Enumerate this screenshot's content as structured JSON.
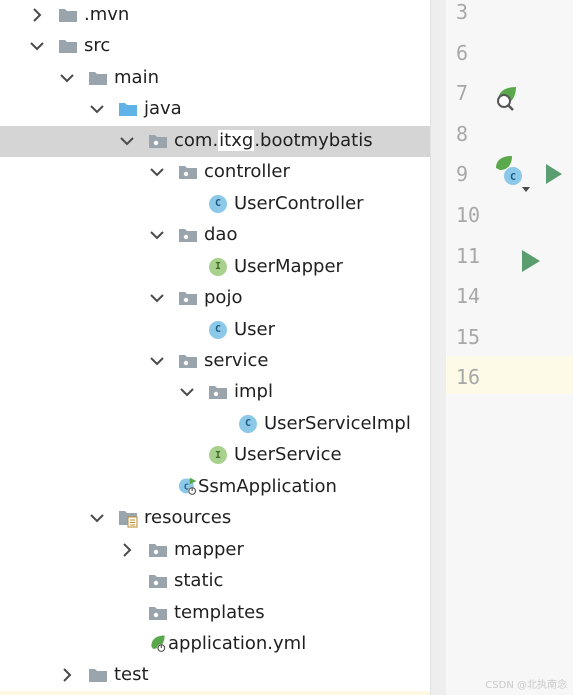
{
  "tree": [
    {
      "label": ".mvn",
      "kind": "folder",
      "expand": "collapsed",
      "level": 0
    },
    {
      "label": "src",
      "kind": "folder",
      "expand": "expanded",
      "level": 0
    },
    {
      "label": "main",
      "kind": "folder",
      "expand": "expanded",
      "level": 1
    },
    {
      "label": "java",
      "kind": "source-folder",
      "expand": "expanded",
      "level": 2
    },
    {
      "label": "com.itxg.bootmybatis",
      "parts": [
        "com.",
        "itxg",
        ".bootmybatis"
      ],
      "kind": "package",
      "expand": "expanded",
      "level": 3,
      "selected": true
    },
    {
      "label": "controller",
      "kind": "package",
      "expand": "expanded",
      "level": 4
    },
    {
      "label": "UserController",
      "kind": "class",
      "level": 5
    },
    {
      "label": "dao",
      "kind": "package",
      "expand": "expanded",
      "level": 4
    },
    {
      "label": "UserMapper",
      "kind": "interface",
      "level": 5
    },
    {
      "label": "pojo",
      "kind": "package",
      "expand": "expanded",
      "level": 4
    },
    {
      "label": "User",
      "kind": "class",
      "level": 5
    },
    {
      "label": "service",
      "kind": "package",
      "expand": "expanded",
      "level": 4
    },
    {
      "label": "impl",
      "kind": "package",
      "expand": "expanded",
      "level": 5
    },
    {
      "label": "UserServiceImpl",
      "kind": "class",
      "level": 6
    },
    {
      "label": "UserService",
      "kind": "interface",
      "level": 5
    },
    {
      "label": "SsmApplication",
      "kind": "spring-app",
      "level": 4
    },
    {
      "label": "resources",
      "kind": "resources-folder",
      "expand": "expanded",
      "level": 2
    },
    {
      "label": "mapper",
      "kind": "package",
      "expand": "collapsed",
      "level": 3
    },
    {
      "label": "static",
      "kind": "package",
      "level": 3
    },
    {
      "label": "templates",
      "kind": "package",
      "level": 3
    },
    {
      "label": "application.yml",
      "kind": "spring-yml",
      "level": 3
    },
    {
      "label": "test",
      "kind": "folder",
      "expand": "collapsed",
      "level": 1
    }
  ],
  "gutter": {
    "line_numbers": [
      "3",
      "6",
      "7",
      "8",
      "9",
      "10",
      "11",
      "14",
      "15",
      "16"
    ],
    "markers": [
      {
        "line": "7",
        "icon": "spring-bean-search-icon"
      },
      {
        "line": "9",
        "icon": "spring-class-run-icon"
      },
      {
        "line": "11",
        "icon": "run-icon"
      }
    ]
  },
  "watermark": "CSDN @北执南念",
  "colors": {
    "selection": "#d5d5d5",
    "folder": "#9aa4ad",
    "source_folder": "#5fb3e6",
    "class_badge": "#8cc8e8",
    "interface_badge": "#a9d18e",
    "run": "#5a9e6f",
    "current_line": "#fdfbe8"
  }
}
